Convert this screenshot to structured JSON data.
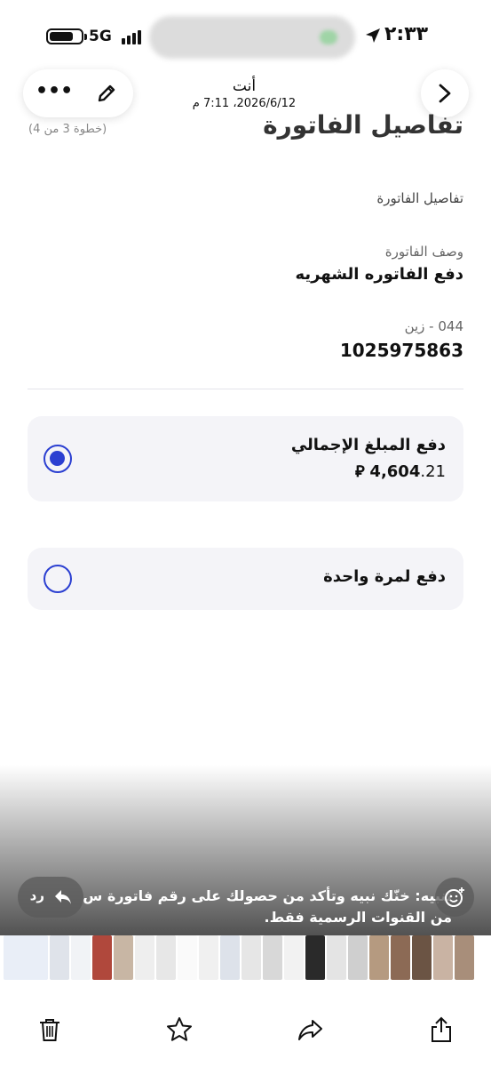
{
  "status_bar": {
    "network": "5G",
    "time": "٢:٣٣"
  },
  "header": {
    "sender": "أنت",
    "date": "2026/6/12، 7:11 م",
    "more_icon": "ellipsis-icon",
    "edit_icon": "pencil-icon",
    "back_icon": "chevron-right-icon"
  },
  "page": {
    "heading": "تفاصيل الفاتورة",
    "step": "(خطوة 3 من 4)"
  },
  "details": {
    "section_title": "تفاصيل الفاتورة",
    "description_label": "وصف الفاتورة",
    "description_value": "دفع الفاتوره الشهريه",
    "biller_label": "044 - زين",
    "account_number": "1025975863"
  },
  "options": [
    {
      "title": "دفع المبلغ الإجمالي",
      "amount_whole": "4,604",
      "amount_fraction": ".21",
      "selected": true
    },
    {
      "title": "دفع لمرة واحدة",
      "selected": false
    }
  ],
  "caption": {
    "line1": "تنبيه: خنّك نبيه وتأكد من حصولك على رقم فاتورة س",
    "line2": "من القنوات الرسمية فقط."
  },
  "reply_label": "رد",
  "colors": {
    "accent": "#2b3fd1",
    "card_bg": "#f4f4f8"
  },
  "toolbar": {
    "icons": [
      "delete-icon",
      "favorite-icon",
      "forward-icon",
      "share-icon"
    ]
  }
}
